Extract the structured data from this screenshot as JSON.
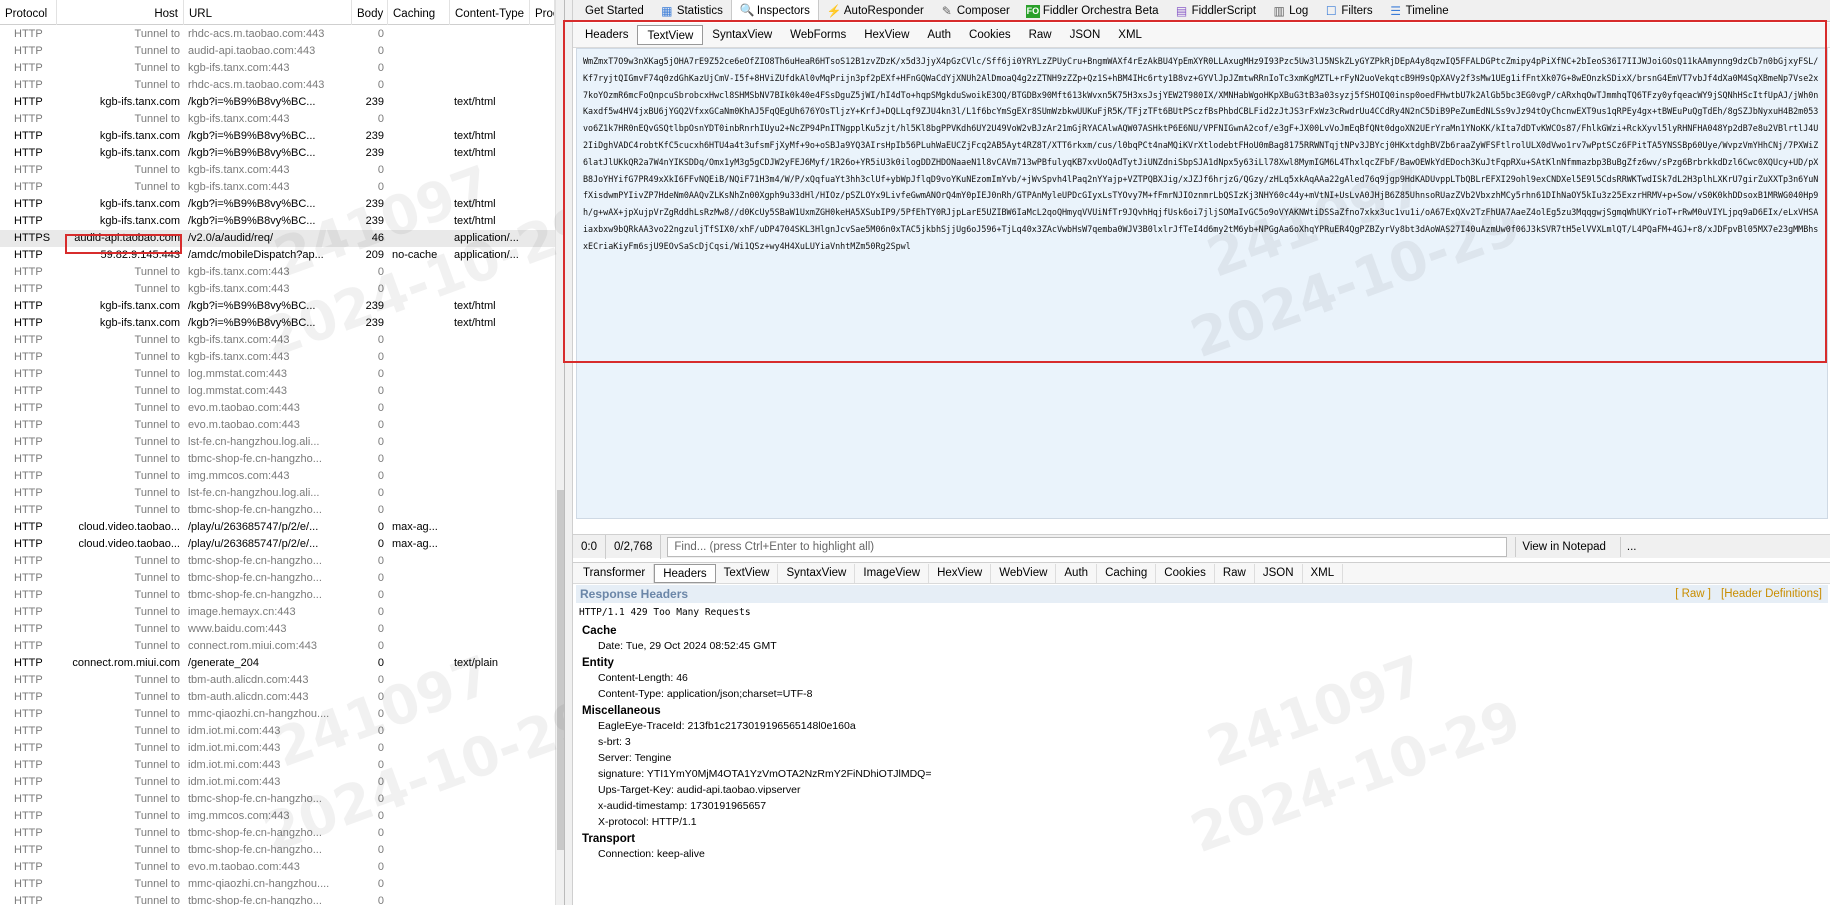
{
  "session_list": {
    "columns": [
      "Protocol",
      "Host",
      "URL",
      "Body",
      "Caching",
      "Content-Type",
      "Proc"
    ],
    "rows": [
      {
        "protocol": "HTTP",
        "host": "Tunnel to",
        "url": "rhdc-acs.m.taobao.com:443",
        "body": "0",
        "caching": "",
        "content_type": "",
        "tunnel": true
      },
      {
        "protocol": "HTTP",
        "host": "Tunnel to",
        "url": "audid-api.taobao.com:443",
        "body": "0",
        "caching": "",
        "content_type": "",
        "tunnel": true
      },
      {
        "protocol": "HTTP",
        "host": "Tunnel to",
        "url": "kgb-ifs.tanx.com:443",
        "body": "0",
        "caching": "",
        "content_type": "",
        "tunnel": true
      },
      {
        "protocol": "HTTP",
        "host": "Tunnel to",
        "url": "rhdc-acs.m.taobao.com:443",
        "body": "0",
        "caching": "",
        "content_type": "",
        "tunnel": true
      },
      {
        "protocol": "HTTP",
        "host": "kgb-ifs.tanx.com",
        "url": "/kgb?i=%B9%B8vy%BC...",
        "body": "239",
        "caching": "",
        "content_type": "text/html",
        "tunnel": false
      },
      {
        "protocol": "HTTP",
        "host": "Tunnel to",
        "url": "kgb-ifs.tanx.com:443",
        "body": "0",
        "caching": "",
        "content_type": "",
        "tunnel": true
      },
      {
        "protocol": "HTTP",
        "host": "kgb-ifs.tanx.com",
        "url": "/kgb?i=%B9%B8vy%BC...",
        "body": "239",
        "caching": "",
        "content_type": "text/html",
        "tunnel": false
      },
      {
        "protocol": "HTTP",
        "host": "kgb-ifs.tanx.com",
        "url": "/kgb?i=%B9%B8vy%BC...",
        "body": "239",
        "caching": "",
        "content_type": "text/html",
        "tunnel": false
      },
      {
        "protocol": "HTTP",
        "host": "Tunnel to",
        "url": "kgb-ifs.tanx.com:443",
        "body": "0",
        "caching": "",
        "content_type": "",
        "tunnel": true
      },
      {
        "protocol": "HTTP",
        "host": "Tunnel to",
        "url": "kgb-ifs.tanx.com:443",
        "body": "0",
        "caching": "",
        "content_type": "",
        "tunnel": true
      },
      {
        "protocol": "HTTP",
        "host": "kgb-ifs.tanx.com",
        "url": "/kgb?i=%B9%B8vy%BC...",
        "body": "239",
        "caching": "",
        "content_type": "text/html",
        "tunnel": false
      },
      {
        "protocol": "HTTP",
        "host": "kgb-ifs.tanx.com",
        "url": "/kgb?i=%B9%B8vy%BC...",
        "body": "239",
        "caching": "",
        "content_type": "text/html",
        "tunnel": false
      },
      {
        "protocol": "HTTPS",
        "host": "audid-api.taobao.com",
        "url": "/v2.0/a/audid/req/",
        "body": "46",
        "caching": "",
        "content_type": "application/...",
        "tunnel": false,
        "selected": true
      },
      {
        "protocol": "HTTP",
        "host": "59.82.9.145:443",
        "url": "/amdc/mobileDispatch?ap...",
        "body": "209",
        "caching": "no-cache",
        "content_type": "application/...",
        "tunnel": false
      },
      {
        "protocol": "HTTP",
        "host": "Tunnel to",
        "url": "kgb-ifs.tanx.com:443",
        "body": "0",
        "caching": "",
        "content_type": "",
        "tunnel": true
      },
      {
        "protocol": "HTTP",
        "host": "Tunnel to",
        "url": "kgb-ifs.tanx.com:443",
        "body": "0",
        "caching": "",
        "content_type": "",
        "tunnel": true
      },
      {
        "protocol": "HTTP",
        "host": "kgb-ifs.tanx.com",
        "url": "/kgb?i=%B9%B8vy%BC...",
        "body": "239",
        "caching": "",
        "content_type": "text/html",
        "tunnel": false
      },
      {
        "protocol": "HTTP",
        "host": "kgb-ifs.tanx.com",
        "url": "/kgb?i=%B9%B8vy%BC...",
        "body": "239",
        "caching": "",
        "content_type": "text/html",
        "tunnel": false
      },
      {
        "protocol": "HTTP",
        "host": "Tunnel to",
        "url": "kgb-ifs.tanx.com:443",
        "body": "0",
        "caching": "",
        "content_type": "",
        "tunnel": true
      },
      {
        "protocol": "HTTP",
        "host": "Tunnel to",
        "url": "kgb-ifs.tanx.com:443",
        "body": "0",
        "caching": "",
        "content_type": "",
        "tunnel": true
      },
      {
        "protocol": "HTTP",
        "host": "Tunnel to",
        "url": "log.mmstat.com:443",
        "body": "0",
        "caching": "",
        "content_type": "",
        "tunnel": true
      },
      {
        "protocol": "HTTP",
        "host": "Tunnel to",
        "url": "log.mmstat.com:443",
        "body": "0",
        "caching": "",
        "content_type": "",
        "tunnel": true
      },
      {
        "protocol": "HTTP",
        "host": "Tunnel to",
        "url": "evo.m.taobao.com:443",
        "body": "0",
        "caching": "",
        "content_type": "",
        "tunnel": true
      },
      {
        "protocol": "HTTP",
        "host": "Tunnel to",
        "url": "evo.m.taobao.com:443",
        "body": "0",
        "caching": "",
        "content_type": "",
        "tunnel": true
      },
      {
        "protocol": "HTTP",
        "host": "Tunnel to",
        "url": "lst-fe.cn-hangzhou.log.ali...",
        "body": "0",
        "caching": "",
        "content_type": "",
        "tunnel": true
      },
      {
        "protocol": "HTTP",
        "host": "Tunnel to",
        "url": "tbmc-shop-fe.cn-hangzho...",
        "body": "0",
        "caching": "",
        "content_type": "",
        "tunnel": true
      },
      {
        "protocol": "HTTP",
        "host": "Tunnel to",
        "url": "img.mmcos.com:443",
        "body": "0",
        "caching": "",
        "content_type": "",
        "tunnel": true
      },
      {
        "protocol": "HTTP",
        "host": "Tunnel to",
        "url": "lst-fe.cn-hangzhou.log.ali...",
        "body": "0",
        "caching": "",
        "content_type": "",
        "tunnel": true
      },
      {
        "protocol": "HTTP",
        "host": "Tunnel to",
        "url": "tbmc-shop-fe.cn-hangzho...",
        "body": "0",
        "caching": "",
        "content_type": "",
        "tunnel": true
      },
      {
        "protocol": "HTTP",
        "host": "cloud.video.taobao...",
        "url": "/play/u/263685747/p/2/e/...",
        "body": "0",
        "caching": "max-ag...",
        "content_type": "",
        "tunnel": false
      },
      {
        "protocol": "HTTP",
        "host": "cloud.video.taobao...",
        "url": "/play/u/263685747/p/2/e/...",
        "body": "0",
        "caching": "max-ag...",
        "content_type": "",
        "tunnel": false
      },
      {
        "protocol": "HTTP",
        "host": "Tunnel to",
        "url": "tbmc-shop-fe.cn-hangzho...",
        "body": "0",
        "caching": "",
        "content_type": "",
        "tunnel": true
      },
      {
        "protocol": "HTTP",
        "host": "Tunnel to",
        "url": "tbmc-shop-fe.cn-hangzho...",
        "body": "0",
        "caching": "",
        "content_type": "",
        "tunnel": true
      },
      {
        "protocol": "HTTP",
        "host": "Tunnel to",
        "url": "tbmc-shop-fe.cn-hangzho...",
        "body": "0",
        "caching": "",
        "content_type": "",
        "tunnel": true
      },
      {
        "protocol": "HTTP",
        "host": "Tunnel to",
        "url": "image.hemayx.cn:443",
        "body": "0",
        "caching": "",
        "content_type": "",
        "tunnel": true
      },
      {
        "protocol": "HTTP",
        "host": "Tunnel to",
        "url": "www.baidu.com:443",
        "body": "0",
        "caching": "",
        "content_type": "",
        "tunnel": true
      },
      {
        "protocol": "HTTP",
        "host": "Tunnel to",
        "url": "connect.rom.miui.com:443",
        "body": "0",
        "caching": "",
        "content_type": "",
        "tunnel": true
      },
      {
        "protocol": "HTTP",
        "host": "connect.rom.miui.com",
        "url": "/generate_204",
        "body": "0",
        "caching": "",
        "content_type": "text/plain",
        "tunnel": false
      },
      {
        "protocol": "HTTP",
        "host": "Tunnel to",
        "url": "tbm-auth.alicdn.com:443",
        "body": "0",
        "caching": "",
        "content_type": "",
        "tunnel": true
      },
      {
        "protocol": "HTTP",
        "host": "Tunnel to",
        "url": "tbm-auth.alicdn.com:443",
        "body": "0",
        "caching": "",
        "content_type": "",
        "tunnel": true
      },
      {
        "protocol": "HTTP",
        "host": "Tunnel to",
        "url": "mmc-qiaozhi.cn-hangzhou....",
        "body": "0",
        "caching": "",
        "content_type": "",
        "tunnel": true
      },
      {
        "protocol": "HTTP",
        "host": "Tunnel to",
        "url": "idm.iot.mi.com:443",
        "body": "0",
        "caching": "",
        "content_type": "",
        "tunnel": true
      },
      {
        "protocol": "HTTP",
        "host": "Tunnel to",
        "url": "idm.iot.mi.com:443",
        "body": "0",
        "caching": "",
        "content_type": "",
        "tunnel": true
      },
      {
        "protocol": "HTTP",
        "host": "Tunnel to",
        "url": "idm.iot.mi.com:443",
        "body": "0",
        "caching": "",
        "content_type": "",
        "tunnel": true
      },
      {
        "protocol": "HTTP",
        "host": "Tunnel to",
        "url": "idm.iot.mi.com:443",
        "body": "0",
        "caching": "",
        "content_type": "",
        "tunnel": true
      },
      {
        "protocol": "HTTP",
        "host": "Tunnel to",
        "url": "tbmc-shop-fe.cn-hangzho...",
        "body": "0",
        "caching": "",
        "content_type": "",
        "tunnel": true
      },
      {
        "protocol": "HTTP",
        "host": "Tunnel to",
        "url": "img.mmcos.com:443",
        "body": "0",
        "caching": "",
        "content_type": "",
        "tunnel": true
      },
      {
        "protocol": "HTTP",
        "host": "Tunnel to",
        "url": "tbmc-shop-fe.cn-hangzho...",
        "body": "0",
        "caching": "",
        "content_type": "",
        "tunnel": true
      },
      {
        "protocol": "HTTP",
        "host": "Tunnel to",
        "url": "tbmc-shop-fe.cn-hangzho...",
        "body": "0",
        "caching": "",
        "content_type": "",
        "tunnel": true
      },
      {
        "protocol": "HTTP",
        "host": "Tunnel to",
        "url": "evo.m.taobao.com:443",
        "body": "0",
        "caching": "",
        "content_type": "",
        "tunnel": true
      },
      {
        "protocol": "HTTP",
        "host": "Tunnel to",
        "url": "mmc-qiaozhi.cn-hangzhou....",
        "body": "0",
        "caching": "",
        "content_type": "",
        "tunnel": true
      },
      {
        "protocol": "HTTP",
        "host": "Tunnel to",
        "url": "tbmc-shop-fe.cn-hangzho...",
        "body": "0",
        "caching": "",
        "content_type": "",
        "tunnel": true
      }
    ]
  },
  "top_tabs": [
    {
      "label": "Get Started",
      "icon": ""
    },
    {
      "label": "Statistics",
      "icon": "statistics-icon"
    },
    {
      "label": "Inspectors",
      "icon": "inspectors-icon",
      "active": true
    },
    {
      "label": "AutoResponder",
      "icon": "lightning-icon"
    },
    {
      "label": "Composer",
      "icon": "composer-icon"
    },
    {
      "label": "Fiddler Orchestra Beta",
      "icon": "fo-icon"
    },
    {
      "label": "FiddlerScript",
      "icon": "script-icon"
    },
    {
      "label": "Log",
      "icon": "log-icon"
    },
    {
      "label": "Filters",
      "icon": "checkbox-icon"
    },
    {
      "label": "Timeline",
      "icon": "timeline-icon"
    }
  ],
  "request_tabs": [
    "Headers",
    "TextView",
    "SyntaxView",
    "WebForms",
    "HexView",
    "Auth",
    "Cookies",
    "Raw",
    "JSON",
    "XML"
  ],
  "request_active_tab": "TextView",
  "request_body": "WmZmxT7O9w3nXKag5jOHA7rE9Z52ce6eOfZIO8Th6uHeaR6HTsoS12B1zvZDzK/x5d3JjyX4pGzCVlc/Sff6ji0YRYLzZPUyCru+BngmWAXf4rEzAkBU4YpEmXYR0LLAxugMHz9I93Pzc5Uw3lJ5NSkZLyGYZPkRjDEpA4y8qzwIQ5FFALDGPtcZmipy4pPiXfNC+2bIeoS36I7IIJWJoiGOsQ11kAAmynng9dzCb7n0bGjxyFSL/Kf7ryjtQIGmvF74q0zdGhKazUjCmV-I5f+8HViZUfdkAl0vMqPrijn3pf2pEXf+HFnGQWaCdYjXNUh2AlDmoaQ4g2zZTNH9zZZp+Qz1S+hBM4IHc6rty1B8vz+GYVlJpJZmtwRRnIoTc3xmKgMZTL+rFyN2uoVekqtcB9H9sQpXAVy2f3sMw1UEg1ifFntXk07G+8wEOnzkSDixX/brsnG4EmVT7vbJf4dXa0M4SqXBmeNp7Vse2x7koYOzmR6mcFoQnpcuSbrobcxHwcl8SHMSbNV7BIk0k40e4FSsDguZ5jWI/hI4dTo+hqpSMgkduSwoikE3OQ/BTGDBx90Mft613kWvxn5K75H3xsJsjYEW2T980IX/XMNHabWgoHKpXBuG3tB3a03syzj5fSHOIQ0insp0oedFHwtbU7k2AlGb5bc3EG0vgP/cARxhqOwTJmmhqTQ6TFzy0yfqeacWY9jSQNhHScItfUpAJ/jWh0nKaxdf5w4HV4jxBU6jYGQ2VfxxGCaNm0KhAJ5FqQEgUh676YOsTljzY+KrfJ+DQLLqf9ZJU4kn3l/L1f6bcYmSgEXr8SUmWzbkwUUKuFjR5K/TFjzTFt6BUtPSczfBsPhbdCBLFid2zJtJS3rFxWz3cRwdrUu4CCdRy4N2nC5DiB9PeZumEdNLSs9vJz94tOyChcnwEXT9us1qRPEy4gx+tBWEuPuQgTdEh/8gSZJbNyxuH4B2m053vo6Z1k7HR0nEQvGSQtlbpOsnYDT0inbRnrhIUyu2+NcZP94PnITNgpplKu5zjt/hl5Kl8bgPPVKdh6UY2U49VoW2vBJzAr21mGjRYACAlwAQW07ASHktP6E6NU/VPFNIGwnA2cof/e3gF+JX00LvVoJmEqBfQNt0dgoXN2UErYraMn1YNoKK/kIta7dDTvKWCOs87/FhlkGWzi+RckXyvl5lyRHNFHA048Yp2dB7e8u2VBlrtlJ4U2IiDghVADC4robtKfC5cucxh6HTU4a4t3ufsmFjXyMf+9o+oSBJa9YQ3AIrsHpIb56PLuhWaEUCZjFcq2AB5Ayt4RZ8T/XTT6rkxm/cus/l0bqPCt4naMQiKVrXtlodebtFHoU0mBag8175RRWNTqjtNPv3JBYcj0HKxtdghBVZb6raaZyWFSFtlrolULX0dVwo1rv7wPptSCz6FPitTA5YNSSBp60Uye/WvpzVmYHhCNj/7PXWiZ6latJlUKkQR2a7W4nYIKSDDq/Omx1yM3g5gCDJW2yFEJ6Myf/1R26o+YR5iU3k0ilogDDZHDONaaeN1l8vCAVm713wPBfulyqKB7xvUoQAdTytJiUNZdniSbpSJA1dNpx5y63iLl78Xwl8MymIGM6L4ThxlqcZFbF/BawOEWkYdEDoch3KuJtFqpRXu+SAtKlnNfmmazbp3BuBgZfz6wv/sPzg6BrbrkkdDzl6Cwc0XQUcy+UD/pXB8JoYHYifG7PR49xXkI6FFvNQEiB/NQiF71H3m4/W/P/xQqfuaYt3hh3clUf+ybWpJflqD9voYKuNEzomImYvb/+jWvSpvh4lPaq2nYYajp+VZTPQBXJig/xJZJf6hrjzG/QGzy/zHLq5xkAqAAa22gAled76q9jgp9HdKADUvppLTbQBLrEFXI29ohl9exCNDXel5E9l5CdsRRWKTwdISk7dL2H3plhLXKrU7girZuXXTp3n6YuNfXisdwmPYIivZP7HdeNm0AAQvZLKsNhZn00Xgph9u33dHl/HIOz/pSZLOYx9LivfeGwmANOrQ4mY0pIEJ0nRh/GTPAnMyleUPDcGIyxLsTYOvy7M+fFmrNJIOznmrLbQSIzKj3NHY60c44y+mVtNI+UsLvA0JHjB6Z85UhnsoRUazZVb2VbxzhMCy5rhn61DIhNaOY5kIu3z25ExzrHRMV+p+Sow/vS0K0khDDsoxB1MRWG040Hp9h/g+wAX+jpXujpVrZgRddhLsRzMw8//d0KcUy5SBaW1UxmZGH0keHA5XSubIP9/5PfEhTY0RJjpLarE5UZIBW6IaMcL2qoQHmyqVVUiNfTr9JQvhHqjfUsk6oi7jljSOMaIvGC5o9oVYAKNWtiDSSaZfno7xkx3uc1vu1i/oA67ExQXv2TzFhUA7AaeZ4olEg5zu3MqqgwjSgmqWhUKYrioT+rRwM0uVIYLjpq9aD6EIx/eLxVHSAiaxbxw9bQRkAA3vo22ngzuljTfSIX0/xhF/uDP4704SKL3HlgnJcvSae5M06n0xTAC5jkbhSjjUg6oJ596+TjLq40x3ZAcVwbHsW7qemba0WJV3B0lxlrJfTeI4d6my2tM6yb+NPGgAa6oXhqYPRuER4QgPZBZyrVy8bt3dAoWAS27I40uAzmUw0f06J3kSVR7tH5elVVXLmlQT/L4PQaFM+4GJ+r8/xJDFpvBl05MX7e23gMMBhsxECriaKiyFm6sjU9EOvSaScDjCqsi/Wi1QSz+wy4H4XuLUYiaVnhtMZm50Rg2Spwl",
  "find_bar": {
    "position": "0:0",
    "count": "0/2,768",
    "placeholder": "Find... (press Ctrl+Enter to highlight all)",
    "notepad_label": "View in Notepad",
    "more_label": "..."
  },
  "response_tabs": [
    "Transformer",
    "Headers",
    "TextView",
    "SyntaxView",
    "ImageView",
    "HexView",
    "WebView",
    "Auth",
    "Caching",
    "Cookies",
    "Raw",
    "JSON",
    "XML"
  ],
  "response_active_tab": "Headers",
  "response_headers": {
    "title": "Response Headers",
    "raw_link": "[ Raw ]",
    "defs_link": "[Header Definitions]",
    "status_line": "HTTP/1.1 429 Too Many Requests",
    "groups": [
      {
        "name": "Cache",
        "headers": [
          "Date: Tue, 29 Oct 2024 08:52:45 GMT"
        ]
      },
      {
        "name": "Entity",
        "headers": [
          "Content-Length: 46",
          "Content-Type: application/json;charset=UTF-8"
        ]
      },
      {
        "name": "Miscellaneous",
        "headers": [
          "EagleEye-TraceId: 213fb1c2173019196565148l0e160a",
          "s-brt: 3",
          "Server: Tengine",
          "signature: YTI1YmY0MjM4OTA1YzVmOTA2NzRmY2FiNDhiOTJlMDQ=",
          "Ups-Target-Key: audid-api.taobao.vipserver",
          "x-audid-timestamp: 1730191965657",
          "X-protocol: HTTP/1.1"
        ]
      },
      {
        "name": "Transport",
        "headers": [
          "Connection: keep-alive"
        ]
      }
    ]
  },
  "colors": {
    "highlight_box": "#d72c2c",
    "textview_bg": "#eaf3fb",
    "header_title": "#6b86a8",
    "link": "#c98d00"
  },
  "watermark": {
    "line1": "241097",
    "line2": "2024-10-29"
  }
}
